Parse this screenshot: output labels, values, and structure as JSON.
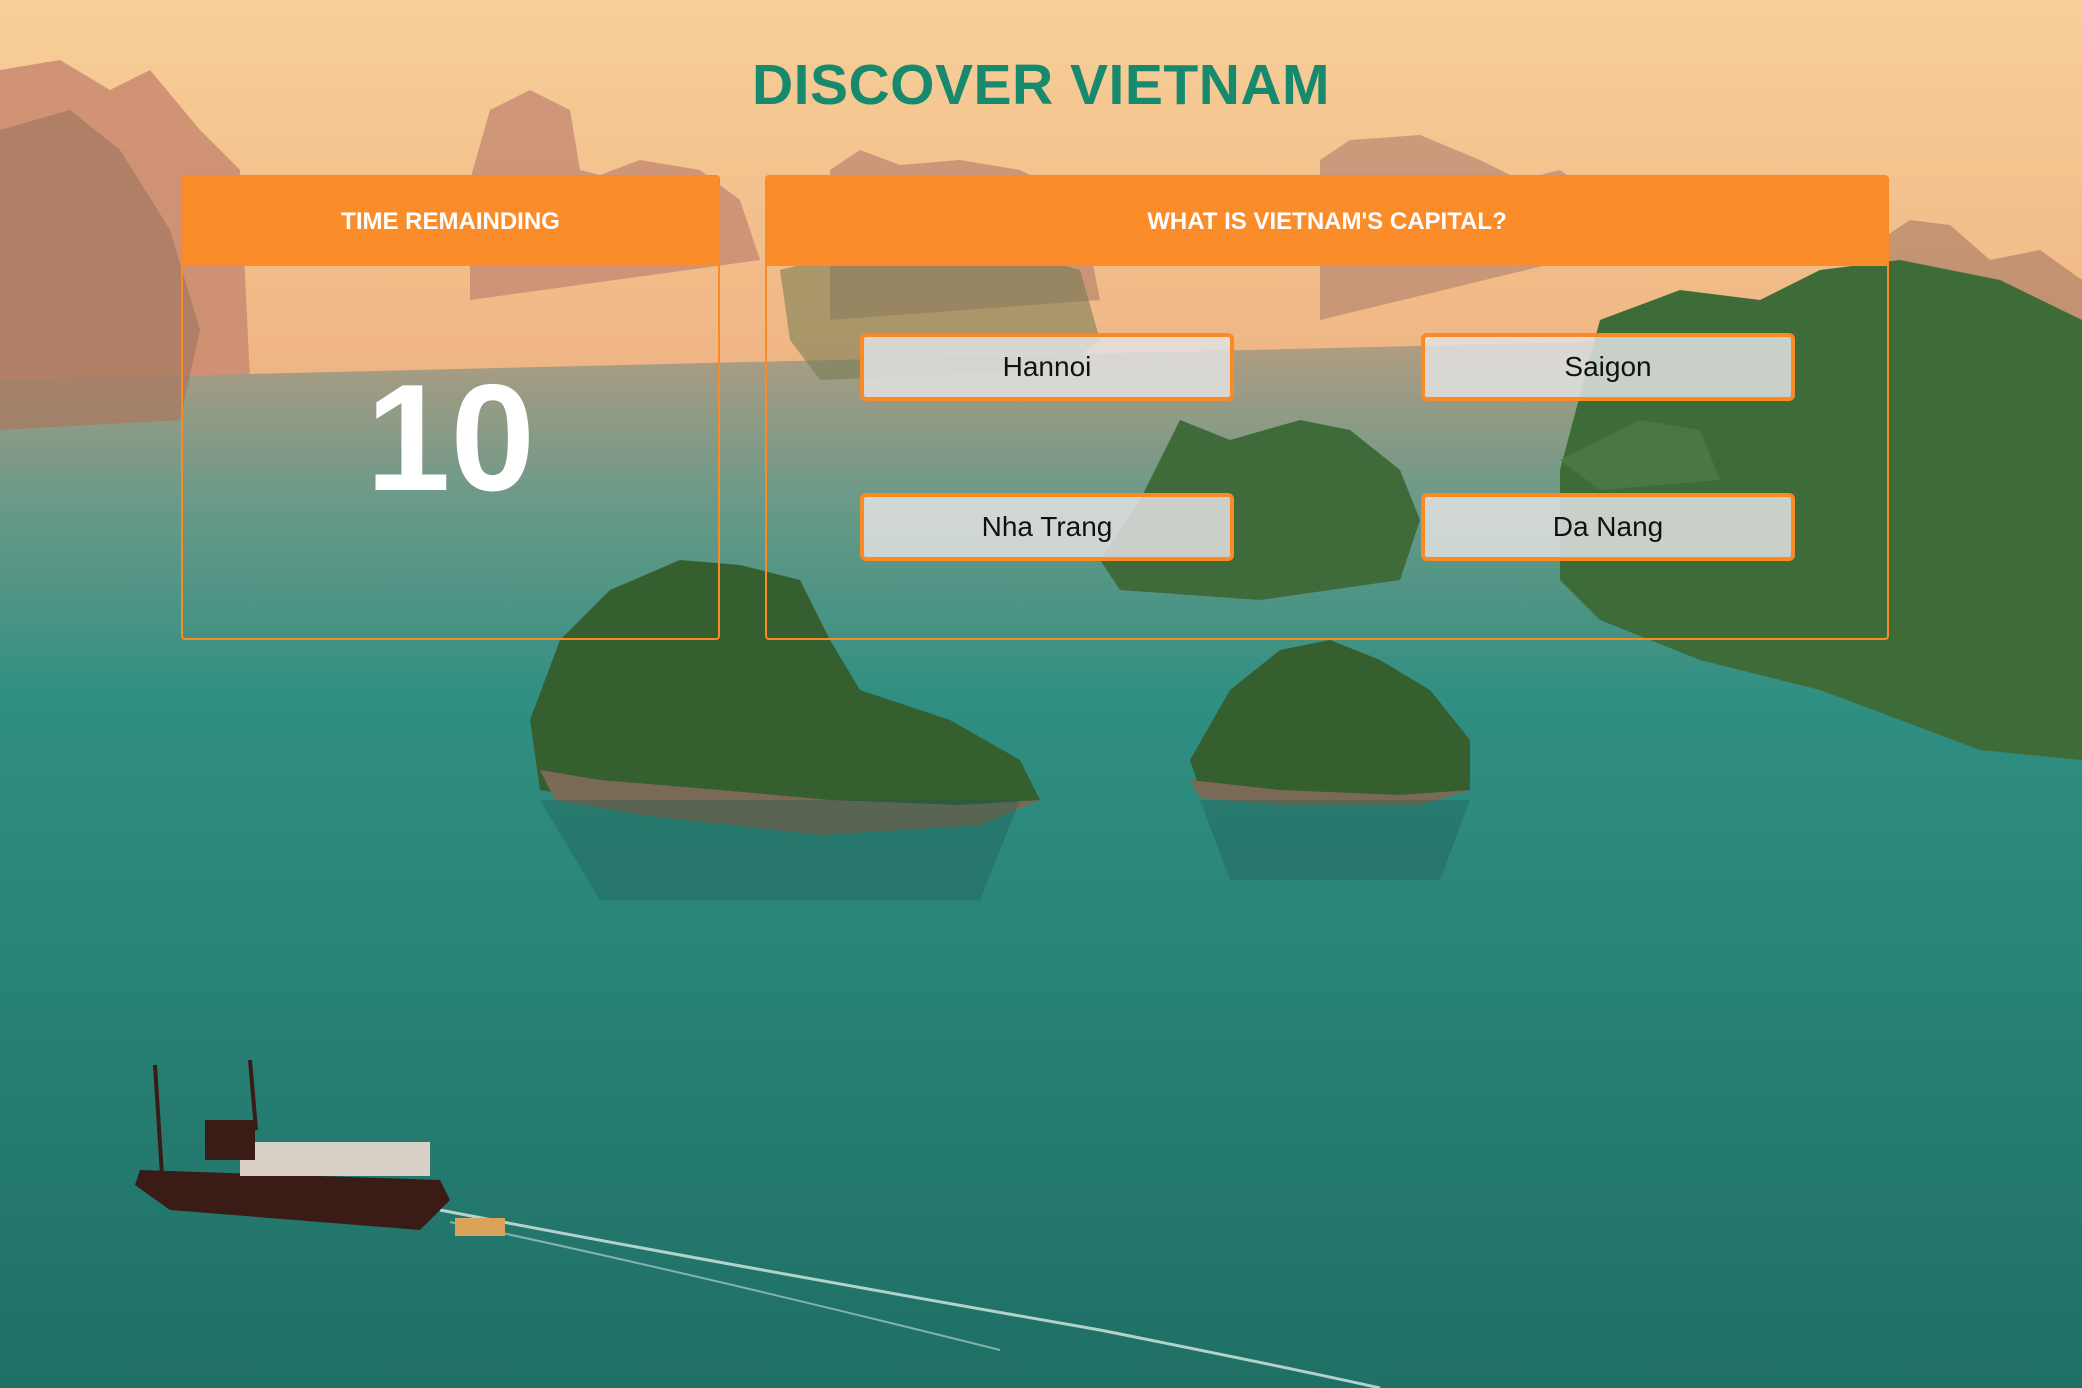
{
  "app": {
    "title": "DISCOVER VIETNAM"
  },
  "timer": {
    "header": "TIME REMAINDING",
    "value": "10"
  },
  "question": {
    "header": "WHAT IS VIETNAM'S CAPITAL?",
    "answers": [
      "Hannoi",
      "Saigon",
      "Nha Trang",
      "Da Nang"
    ]
  },
  "colors": {
    "accent": "#fb8c2a",
    "title": "#178a6e",
    "sky": "#f5c48a",
    "water": "#2e8b7e"
  }
}
